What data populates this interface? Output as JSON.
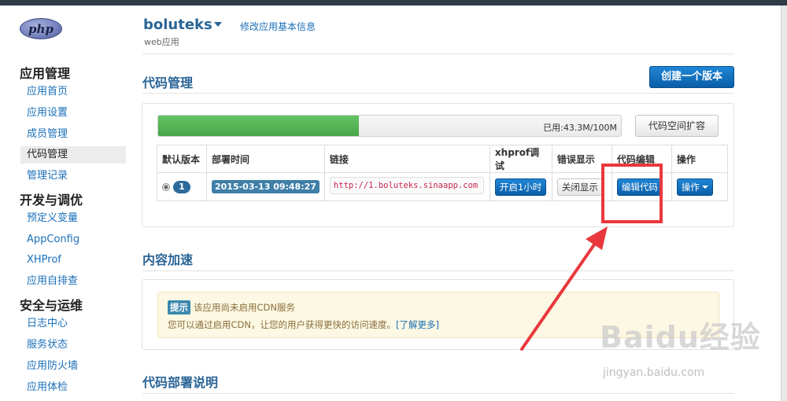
{
  "logo": {
    "text": "php"
  },
  "header": {
    "app_name": "boluteks",
    "app_type": "web应用",
    "edit_info_link": "修改应用基本信息"
  },
  "sidebar": {
    "groups": [
      {
        "title": "应用管理",
        "items": [
          "应用首页",
          "应用设置",
          "成员管理",
          "代码管理",
          "管理记录"
        ]
      },
      {
        "title": "开发与调优",
        "items": [
          "预定义变量",
          "AppConfig",
          "XHProf",
          "应用自排查"
        ]
      },
      {
        "title": "安全与运维",
        "items": [
          "日志中心",
          "服务状态",
          "应用防火墙",
          "应用体检"
        ]
      }
    ],
    "active_item": "代码管理"
  },
  "code_section": {
    "title": "代码管理",
    "create_version_button": "创建一个版本",
    "usage": {
      "text": "已用:43.3M/100M",
      "used_mb": 43.3,
      "total_mb": 100
    },
    "expand_button": "代码空间扩容",
    "table": {
      "headers": [
        "默认版本",
        "部署时间",
        "链接",
        "xhprof调试",
        "错误显示",
        "代码编辑",
        "操作"
      ],
      "rows": [
        {
          "version": "1",
          "deploy_time": "2015-03-13 09:48:27",
          "link": "http://1.boluteks.sinaapp.com",
          "xhprof": "开启1小时",
          "error_display": "关闭显示",
          "code_edit": "编辑代码",
          "actions": "操作"
        }
      ]
    }
  },
  "cdn_section": {
    "title": "内容加速",
    "alert_label": "提示",
    "alert_line1": "该应用尚未启用CDN服务",
    "alert_line2": "您可以通过启用CDN，让您的用户获得更快的访问速度。",
    "alert_link": "[了解更多]"
  },
  "deploy_section": {
    "title": "代码部署说明"
  },
  "watermark": {
    "brand": "Baidu经验",
    "url": "jingyan.baidu.com"
  },
  "colors": {
    "primary": "#0b5ea8",
    "link": "#1a6fb8",
    "progress": "#4aa54a",
    "annotation": "#e8383d"
  }
}
